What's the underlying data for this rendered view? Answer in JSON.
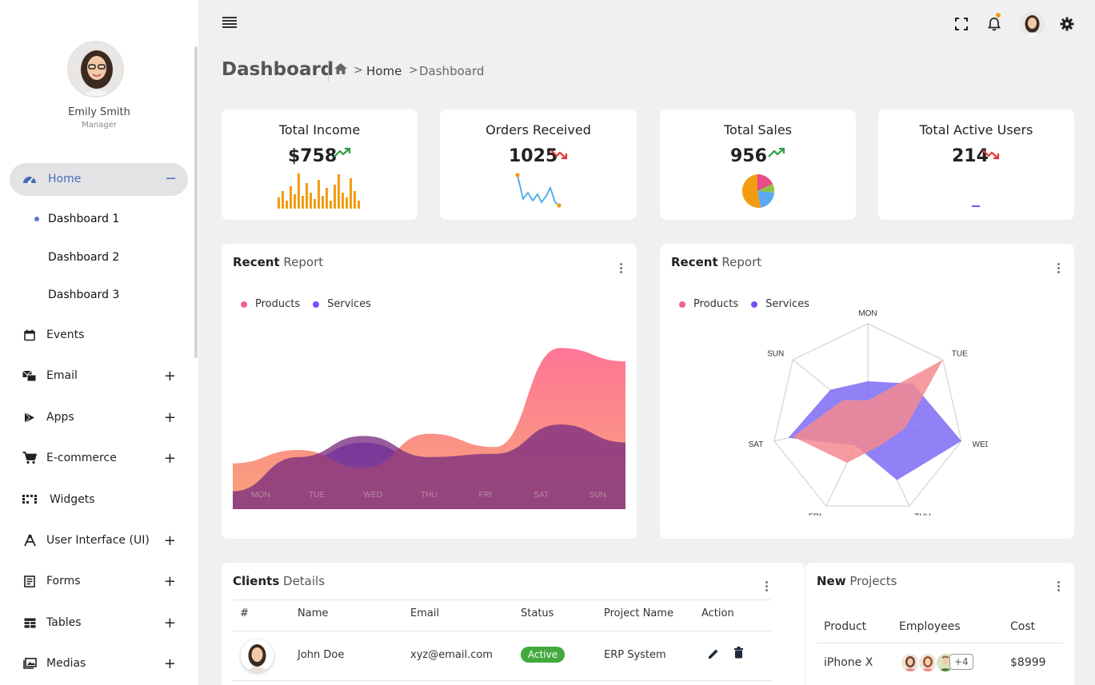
{
  "sidebar": {
    "user_name": "Emily Smith",
    "user_role": "Manager",
    "home_label": "Home",
    "home_toggle": "−",
    "submenu": [
      "Dashboard 1",
      "Dashboard 2",
      "Dashboard 3"
    ],
    "items": [
      {
        "label": "Events",
        "icon": "calendar-icon",
        "expand": ""
      },
      {
        "label": "Email",
        "icon": "email-icon",
        "expand": "+"
      },
      {
        "label": "Apps",
        "icon": "apps-icon",
        "expand": "+"
      },
      {
        "label": "E-commerce",
        "icon": "cart-icon",
        "expand": "+"
      },
      {
        "label": "Widgets",
        "icon": "widgets-icon",
        "expand": ""
      },
      {
        "label": "User Interface (UI)",
        "icon": "ui-icon",
        "expand": "+"
      },
      {
        "label": "Forms",
        "icon": "forms-icon",
        "expand": "+"
      },
      {
        "label": "Tables",
        "icon": "tables-icon",
        "expand": "+"
      },
      {
        "label": "Medias",
        "icon": "medias-icon",
        "expand": "+"
      }
    ]
  },
  "breadcrumb": {
    "page_title": "Dashboard",
    "sep1": ">",
    "home": "Home",
    "sep2": ">",
    "current": "Dashboard"
  },
  "stats": [
    {
      "title": "Total Income",
      "value": "$758",
      "trend": "up"
    },
    {
      "title": "Orders Received",
      "value": "1025",
      "trend": "down"
    },
    {
      "title": "Total Sales",
      "value": "956",
      "trend": "up"
    },
    {
      "title": "Total Active Users",
      "value": "214",
      "trend": "down"
    }
  ],
  "colors": {
    "products": "#f06292",
    "services": "#7c4dff",
    "orange": "#f39c12",
    "trend_up": "#2e9e44",
    "trend_down": "#e53935",
    "active_badge": "#43a93e"
  },
  "recent_report_left": {
    "title_bold": "Recent",
    "title_rest": " Report",
    "legend": [
      "Products",
      "Services"
    ]
  },
  "recent_report_right": {
    "title_bold": "Recent",
    "title_rest": " Report",
    "legend": [
      "Products",
      "Services"
    ]
  },
  "chart_data": [
    {
      "type": "area",
      "categories": [
        "MON",
        "TUE",
        "WED",
        "THU",
        "FRI",
        "SAT",
        "SUN"
      ],
      "series": [
        {
          "name": "Products",
          "values": [
            31,
            40,
            28,
            51,
            42,
            109,
            100
          ]
        },
        {
          "name": "Services",
          "values": [
            11,
            32,
            45,
            32,
            34,
            52,
            41
          ]
        }
      ]
    },
    {
      "type": "radar",
      "categories": [
        "MON",
        "TUE",
        "WED",
        "THU",
        "FRI",
        "SAT",
        "SUN"
      ],
      "series": [
        {
          "name": "Products",
          "values": [
            20,
            100,
            40,
            30,
            50,
            80,
            33
          ]
        },
        {
          "name": "Services",
          "values": [
            40,
            60,
            100,
            70,
            30,
            85,
            50
          ]
        }
      ]
    }
  ],
  "clients": {
    "title_bold": "Clients",
    "title_rest": " Details",
    "columns": [
      "#",
      "Name",
      "Email",
      "Status",
      "Project Name",
      "Action"
    ],
    "rows": [
      {
        "name": "John Doe",
        "email": "xyz@email.com",
        "status": "Active",
        "project": "ERP System"
      }
    ]
  },
  "projects": {
    "title_bold": "New",
    "title_rest": " Projects",
    "columns": [
      "Product",
      "Employees",
      "Cost"
    ],
    "rows": [
      {
        "product": "iPhone X",
        "more": "+4",
        "cost": "$8999"
      }
    ]
  }
}
